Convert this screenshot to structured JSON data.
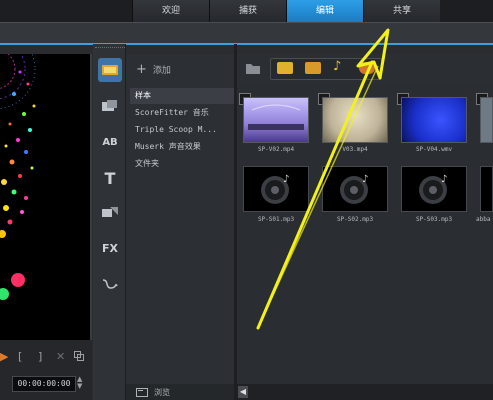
{
  "tabs": [
    "欢迎",
    "捕获",
    "编辑",
    "共享"
  ],
  "active_tab": "编辑",
  "library": {
    "add_label": "添加",
    "items": [
      "样本",
      "ScoreFitter 音乐",
      "Triple Scoop M...",
      "Muserk 声音效果",
      "文件夹"
    ],
    "selected": "样本",
    "browse_label": "浏览"
  },
  "tools": [
    "media-icon",
    "instant-project-icon",
    "title-ab-icon",
    "text-icon",
    "transition-icon",
    "fx-icon",
    "path-icon"
  ],
  "tool_labels": {
    "ab": "AB",
    "text": "T",
    "fx": "FX"
  },
  "media_filters": [
    "folder-icon",
    "video-filter-icon",
    "photo-filter-icon",
    "music-filter-icon",
    "effects-filter-icon"
  ],
  "thumbnails": [
    {
      "caption": "SP-V02.mp4",
      "kind": "video",
      "color": "#8f7fd8"
    },
    {
      "caption": "V03.mp4",
      "kind": "video",
      "color": "#bfb49a"
    },
    {
      "caption": "SP-V04.wmv",
      "kind": "video",
      "color": "#1a2fc9"
    },
    {
      "caption": "SP-S01.mp3",
      "kind": "audio"
    },
    {
      "caption": "SP-S02.mp3",
      "kind": "audio"
    },
    {
      "caption": "SP-S03.mp3",
      "kind": "audio"
    }
  ],
  "partial_caption": "abba",
  "timecode": "00:00:00:00",
  "playback": {
    "mark_in": "[",
    "mark_out": "]",
    "cut": "✕",
    "play": "▶"
  },
  "colors": {
    "accent": "#2d9ee6",
    "arrow": "#f2f21a"
  }
}
